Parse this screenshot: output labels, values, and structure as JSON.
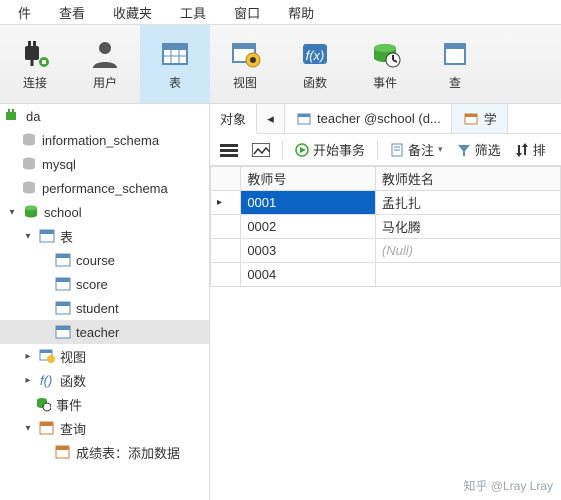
{
  "menubar": {
    "items": [
      "件",
      "查看",
      "收藏夹",
      "工具",
      "窗口",
      "帮助"
    ]
  },
  "ribbon": {
    "items": [
      {
        "label": "连接",
        "name": "connection"
      },
      {
        "label": "用户",
        "name": "user"
      },
      {
        "label": "表",
        "name": "table",
        "active": true
      },
      {
        "label": "视图",
        "name": "view"
      },
      {
        "label": "函数",
        "name": "function"
      },
      {
        "label": "事件",
        "name": "event"
      },
      {
        "label": "查",
        "name": "query"
      }
    ]
  },
  "tree": {
    "conn": "da",
    "dbs": [
      "information_schema",
      "mysql",
      "performance_schema"
    ],
    "school": "school",
    "folders": {
      "tables": "表",
      "views": "视图",
      "funcs": "函数",
      "events": "事件",
      "queries": "查询"
    },
    "tables": [
      "course",
      "score",
      "student",
      "teacher"
    ],
    "query_item": "成绩表：添加数据"
  },
  "tabs": {
    "objects": "对象",
    "teacher": "teacher @school (d...",
    "student_partial": "学"
  },
  "toolbar": {
    "begin_tx": "开始事务",
    "memo": "备注",
    "filter": "筛选",
    "sort": "排"
  },
  "grid": {
    "cols": [
      "教师号",
      "教师姓名"
    ],
    "rows": [
      {
        "id": "0001",
        "name": "孟扎扎",
        "selected": true
      },
      {
        "id": "0002",
        "name": "马化腾"
      },
      {
        "id": "0003",
        "name": "(Null)",
        "null": true
      },
      {
        "id": "0004",
        "name": ""
      }
    ]
  },
  "watermark": "知乎 @Lray Lray"
}
